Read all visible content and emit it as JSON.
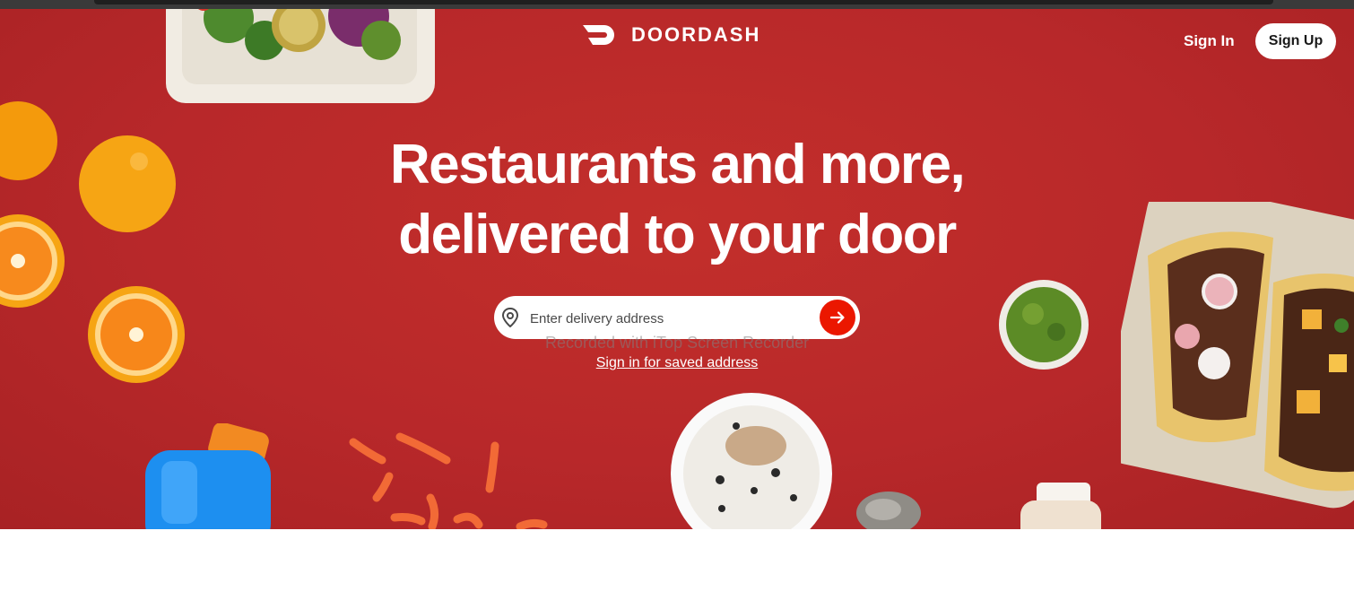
{
  "browser": {
    "chrome": "tab-strip"
  },
  "header": {
    "brand": "DOORDASH",
    "sign_in_label": "Sign In",
    "sign_up_label": "Sign Up"
  },
  "hero": {
    "headline_line1": "Restaurants and more,",
    "headline_line2": "delivered to your door",
    "address_placeholder": "Enter delivery address",
    "address_value": "",
    "saved_address_link": "Sign in for saved address",
    "watermark": "Recorded with iTop Screen Recorder"
  },
  "colors": {
    "hero_background": "#b8282a",
    "primary": "#eb1700",
    "text_on_hero": "#ffffff"
  },
  "icons": [
    "doordash-logo-icon",
    "location-pin-icon",
    "arrow-right-icon"
  ]
}
